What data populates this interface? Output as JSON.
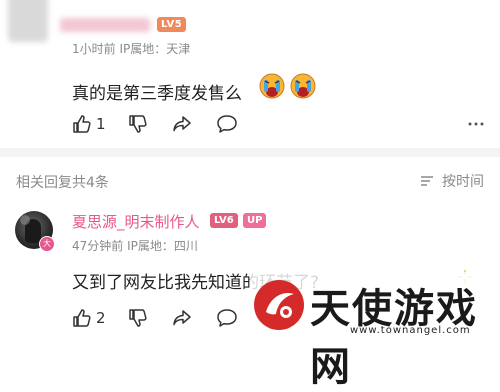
{
  "comment": {
    "level_badge": "LV5",
    "meta": "1小时前  IP属地：天津",
    "text": "真的是第三季度发售么",
    "emoji": [
      "crying-face-emoji",
      "crying-face-emoji"
    ],
    "like_count": "1"
  },
  "replies_section": {
    "title": "相关回复共4条",
    "sort_label": "按时间"
  },
  "reply": {
    "author": "夏思源_明末制作人",
    "level_badge": "LV6",
    "up_badge": "UP",
    "avatar_badge": "大",
    "meta": "47分钟前  IP属地：四川",
    "text": "又到了网友比我先知道的环节了?",
    "like_count": "2"
  },
  "watermark": {
    "title": "天使游戏网",
    "url": "www.townangel.com"
  },
  "colors": {
    "name_pink": "#e8578d",
    "lv5_orange": "#f08a5d",
    "lv6_pink": "#e0607e",
    "up_pink": "#f06f9a",
    "watermark_red": "#d42a2a"
  }
}
